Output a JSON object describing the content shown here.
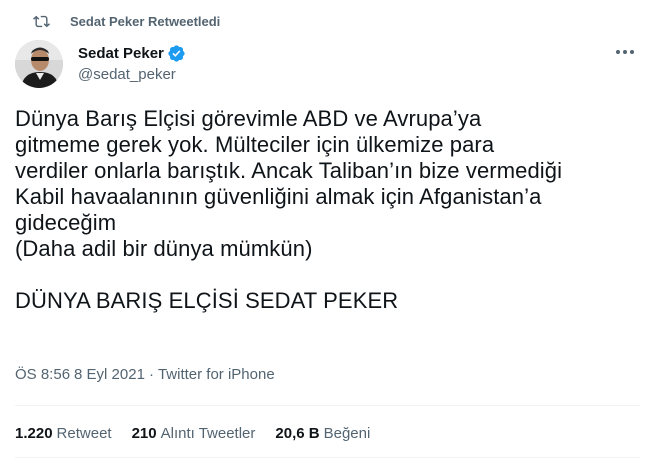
{
  "retweet_banner": {
    "text": "Sedat Peker Retweetledi",
    "icon": "retweet-icon"
  },
  "author": {
    "name": "Sedat Peker",
    "handle": "@sedat_peker",
    "verified": true,
    "verified_color": "#1d9bf0"
  },
  "tweet": {
    "lines": [
      "Dünya Barış Elçisi görevimle ABD ve Avrupa’ya",
      "gitmeme gerek yok. Mülteciler için ülkemize para",
      "verdiler onlarla barıştık. Ancak Taliban’ın bize vermediği",
      "Kabil havaalanının güvenliğini almak için Afganistan’a",
      "gideceğim",
      "(Daha adil bir dünya mümkün)",
      "",
      "DÜNYA BARIŞ ELÇİSİ SEDAT PEKER"
    ]
  },
  "meta": {
    "time": "ÖS 8:56",
    "date": "8 Eyl 2021",
    "separator": "·",
    "source": "Twitter for iPhone"
  },
  "stats": {
    "retweets": {
      "count": "1.220",
      "label": "Retweet"
    },
    "quotes": {
      "count": "210",
      "label": "Alıntı Tweetler"
    },
    "likes": {
      "count": "20,6 B",
      "label": "Beğeni"
    }
  },
  "colors": {
    "text": "#0f1419",
    "secondary": "#536471",
    "divider": "#eff3f4"
  }
}
